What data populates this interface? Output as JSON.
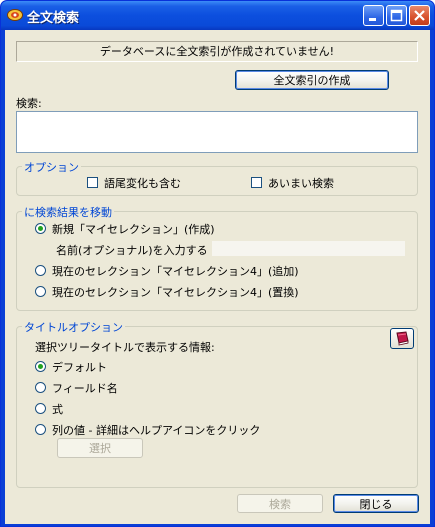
{
  "window": {
    "title": "全文検索",
    "icon": "app-icon",
    "controls": [
      "minimize-icon",
      "maximize-icon",
      "close-icon"
    ]
  },
  "status": {
    "message": "データベースに全文索引が作成されていません!"
  },
  "create_index_button": "全文索引の作成",
  "search": {
    "label": "検索:",
    "value": ""
  },
  "options": {
    "legend": "オプション",
    "inflection_label": "語尾変化も含む",
    "inflection_checked": false,
    "fuzzy_label": "あいまい検索",
    "fuzzy_checked": false
  },
  "move_results": {
    "legend": "に検索結果を移動",
    "new_label": "新規「マイセレクション」(作成)",
    "name_label": "名前(オプショナル)を入力する",
    "name_value": "",
    "add_label": "現在のセレクション「マイセレクション4」(追加)",
    "replace_label": "現在のセレクション「マイセレクション4」(置換)",
    "selected": "new"
  },
  "title_options": {
    "legend": "タイトルオプション",
    "info_label": "選択ツリータイトルで表示する情報:",
    "default_label": "デフォルト",
    "field_label": "フィールド名",
    "formula_label": "式",
    "column_label": "列の値 - 詳細はヘルプアイコンをクリック",
    "selected": "default",
    "select_button": "選択",
    "help_icon": "help-book-icon"
  },
  "footer": {
    "search_button": "検索",
    "close_button": "閉じる"
  },
  "colors": {
    "title_bar": "#0a4ad8",
    "dialog_bg": "#ece9d8",
    "group_legend": "#0046d5",
    "radio_dot": "#21a121"
  }
}
